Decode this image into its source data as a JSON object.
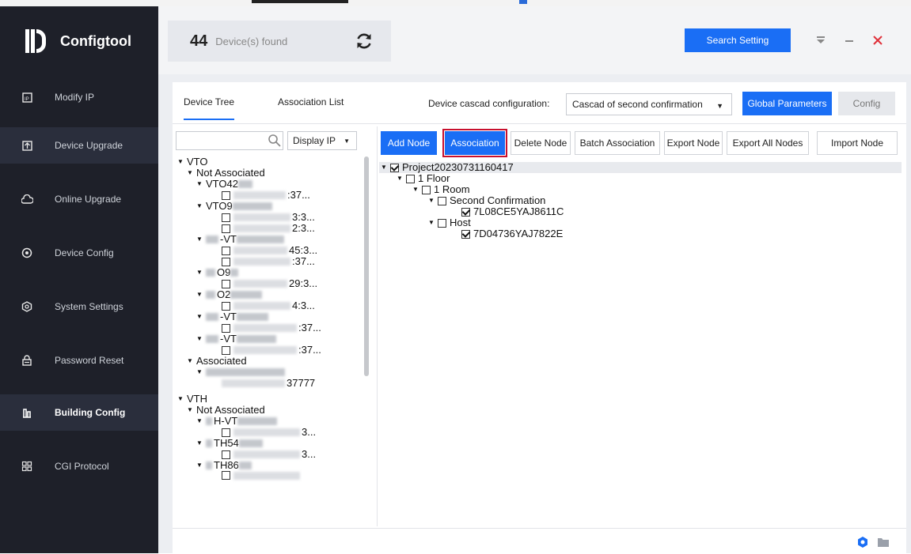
{
  "app": {
    "name": "Configtool"
  },
  "sidebar": {
    "items": [
      {
        "label": "Modify IP",
        "icon": "ip-icon"
      },
      {
        "label": "Device Upgrade",
        "icon": "upload-icon"
      },
      {
        "label": "Online Upgrade",
        "icon": "cloud-icon"
      },
      {
        "label": "Device Config",
        "icon": "config-icon"
      },
      {
        "label": "System Settings",
        "icon": "settings-icon"
      },
      {
        "label": "Password Reset",
        "icon": "lock-icon"
      },
      {
        "label": "Building Config",
        "icon": "building-icon"
      },
      {
        "label": "CGI Protocol",
        "icon": "grid-icon"
      }
    ]
  },
  "header": {
    "count": "44",
    "count_label": "Device(s) found",
    "search_setting": "Search Setting"
  },
  "tabs": [
    {
      "label": "Device Tree"
    },
    {
      "label": "Association List"
    }
  ],
  "cascade": {
    "label": "Device cascad configuration:",
    "value": "Cascad of second confirmation"
  },
  "buttons": {
    "global_parameters": "Global Parameters",
    "config": "Config",
    "add_node": "Add Node",
    "association": "Association",
    "delete_node": "Delete Node",
    "batch_association": "Batch Association",
    "export_node": "Export Node",
    "export_all_nodes": "Export All Nodes",
    "import_node": "Import Node"
  },
  "left_tree": {
    "display_select": "Display IP",
    "vto": "VTO",
    "not_associated": "Not Associated",
    "associated": "Associated",
    "vth": "VTH",
    "nodes": [
      {
        "name": "VTO42",
        "tail": ":37..."
      },
      {
        "name": "VTO9",
        "tail": "3:3..."
      },
      {
        "tail": "2:3..."
      },
      {
        "name": "-VT",
        "tail": "45:3..."
      },
      {
        "tail": ":37..."
      },
      {
        "name": "O9",
        "tail": "29:3..."
      },
      {
        "name": "O2",
        "tail": "4:3..."
      },
      {
        "name": "-VT",
        "tail": ":37..."
      },
      {
        "name": "-VT",
        "tail": ":37..."
      },
      {
        "tail": "37777"
      },
      {
        "name": "H-VT",
        "tail": "3..."
      },
      {
        "name": "TH54",
        "tail": "3..."
      },
      {
        "name": "TH86"
      }
    ]
  },
  "right_tree": {
    "project": "Project20230731160417",
    "floor": "1 Floor",
    "room": "1 Room",
    "second_confirmation": "Second Confirmation",
    "device1": "7L08CE5YAJ8611C",
    "host": "Host",
    "device2": "7D04736YAJ7822E"
  }
}
